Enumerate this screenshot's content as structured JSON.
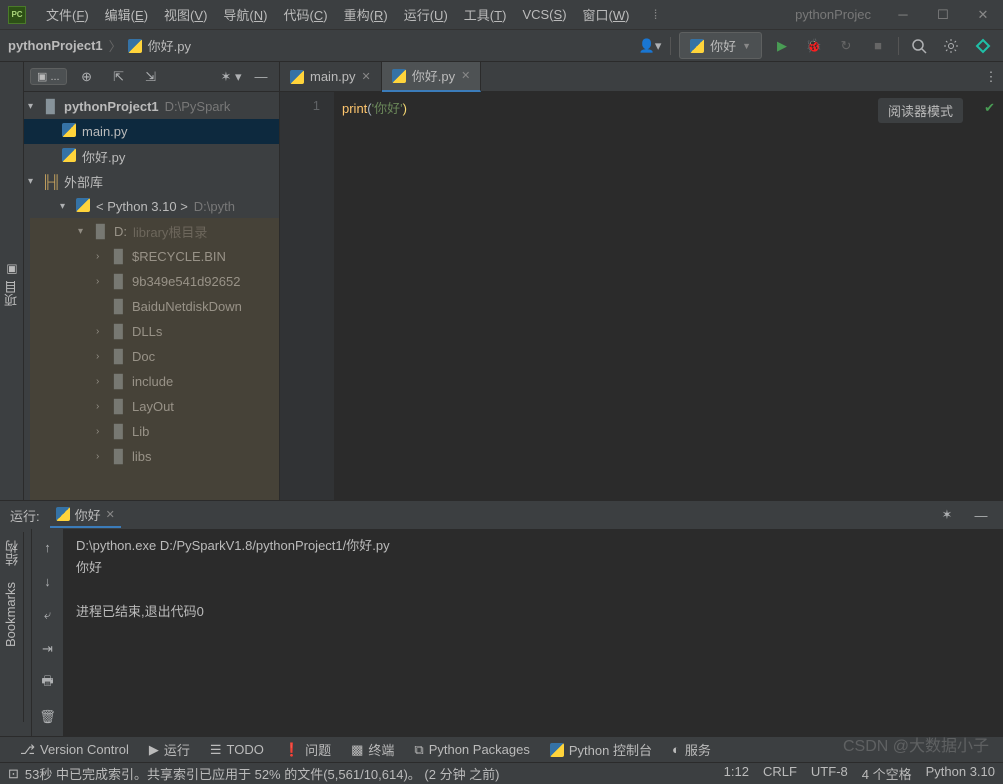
{
  "titlebar": {
    "logo": "PC",
    "menus": [
      {
        "label": "文件",
        "mn": "F"
      },
      {
        "label": "编辑",
        "mn": "E"
      },
      {
        "label": "视图",
        "mn": "V"
      },
      {
        "label": "导航",
        "mn": "N"
      },
      {
        "label": "代码",
        "mn": "C"
      },
      {
        "label": "重构",
        "mn": "R"
      },
      {
        "label": "运行",
        "mn": "U"
      },
      {
        "label": "工具",
        "mn": "T"
      },
      {
        "label": "VCS",
        "mn": "S"
      },
      {
        "label": "窗口",
        "mn": "W"
      }
    ],
    "title": "pythonProjec"
  },
  "breadcrumb": {
    "project": "pythonProject1",
    "file": "你好.py"
  },
  "run_config": {
    "label": "你好"
  },
  "left_gutter": {
    "project": "项目"
  },
  "left_gutter2": {
    "structure": "结构",
    "bookmarks": "Bookmarks"
  },
  "tree": {
    "root": {
      "label": "pythonProject1",
      "hint": "D:\\PySpark"
    },
    "files": [
      "main.py",
      "你好.py"
    ],
    "ext_lib": "外部库",
    "python_env": "< Python 3.10 >",
    "python_hint": "D:\\pyth",
    "d_drive": "D:",
    "d_hint": "library根目录",
    "folders": [
      "$RECYCLE.BIN",
      "9b349e541d92652",
      "BaiduNetdiskDown",
      "DLLs",
      "Doc",
      "include",
      "LayOut",
      "Lib",
      "libs"
    ]
  },
  "editor": {
    "tabs": [
      {
        "name": "main.py",
        "active": false
      },
      {
        "name": "你好.py",
        "active": true
      }
    ],
    "line_no": "1",
    "code": {
      "fn": "print",
      "lp": "(",
      "str": "'你好'",
      "rp": ")"
    },
    "reader": "阅读器模式"
  },
  "run_panel": {
    "title": "运行:",
    "tab": "你好",
    "out_path": "D:\\python.exe D:/PySparkV1.8/pythonProject1/你好.py",
    "out_line": "你好",
    "exit_line": "进程已结束,退出代码0"
  },
  "bottom": [
    {
      "icon": "vcs",
      "label": "Version Control"
    },
    {
      "icon": "run",
      "label": "运行"
    },
    {
      "icon": "todo",
      "label": "TODO"
    },
    {
      "icon": "prob",
      "label": "问题"
    },
    {
      "icon": "term",
      "label": "终端"
    },
    {
      "icon": "pkg",
      "label": "Python Packages"
    },
    {
      "icon": "pycon",
      "label": "Python 控制台"
    },
    {
      "icon": "svc",
      "label": "服务"
    }
  ],
  "status": {
    "msg": "53秒 中已完成索引。共享索引已应用于 52% 的文件(5,561/10,614)。 (2 分钟 之前)",
    "pos": "1:12",
    "crlf": "CRLF",
    "enc": "UTF-8",
    "indent": "4 个空格",
    "lang": "Python 3.10"
  },
  "watermark": "CSDN @大数据小子"
}
